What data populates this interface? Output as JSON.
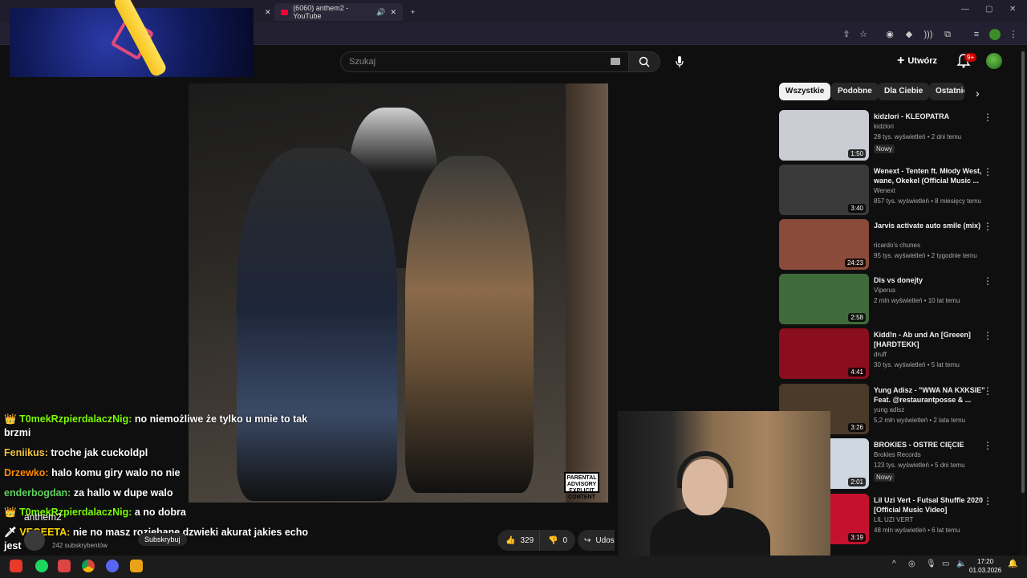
{
  "browser": {
    "tab_title": "(6060) anthem2 - YouTube"
  },
  "youtube": {
    "search_placeholder": "Szukaj",
    "create_label": "Utwórz",
    "notifications_badge": "9+",
    "chips": [
      "Wszystkie",
      "Podobne",
      "Dla Ciebie",
      "Ostatnio"
    ],
    "video": {
      "channel_name": "anthem2",
      "channel_subs": "242 subskrybentów",
      "subscribe_label": "Subskrybuj",
      "likes": "329",
      "dislikes": "0",
      "share_label": "Udos",
      "advisory_text": "PARENTAL ADVISORY EXPLICIT CONTENT"
    },
    "recommendations": [
      {
        "title": "kidzlori - KLEOPATRA",
        "channel": "kidzlori",
        "meta": "28 tys. wyświetleń • 2 dni temu",
        "badge": "Nowy",
        "duration": "1:50",
        "thumb": "#c9ccd2"
      },
      {
        "title": "Wenext - Tenten ft. Młody West, wane, Okekel (Official Music ...",
        "channel": "Wenext",
        "meta": "857 tys. wyświetleń • 8 miesięcy temu",
        "badge": "",
        "duration": "3:40",
        "thumb": "#3a3a3a"
      },
      {
        "title": "Jarvis activate auto smile (mix)",
        "channel": "ricardo's chunes",
        "meta": "95 tys. wyświetleń • 2 tygodnie temu",
        "badge": "",
        "duration": "24:23",
        "thumb": "#8a4b3a"
      },
      {
        "title": "Dis vs donejty",
        "channel": "Viperus",
        "meta": "2 mln wyświetleń • 10 lat temu",
        "badge": "",
        "duration": "2:58",
        "thumb": "#3f6b3a"
      },
      {
        "title": "Kidd!n - Ab und An [Greeen] [HARDTEKK]",
        "channel": "druff",
        "meta": "30 tys. wyświetleń • 5 lat temu",
        "badge": "",
        "duration": "4:41",
        "thumb": "#8a0e1e"
      },
      {
        "title": "Yung Adisz - \"WWA NA KXKSIE\" Feat. @restaurantposse & ...",
        "channel": "yung adisz",
        "meta": "5,2 mln wyświetleń • 2 lata temu",
        "badge": "",
        "duration": "3:26",
        "thumb": "#4a3a2a"
      },
      {
        "title": "BROKIES - OSTRE CIĘCIE",
        "channel": "Brokies Records",
        "meta": "123 tys. wyświetleń • 5 dni temu",
        "badge": "Nowy",
        "duration": "2:01",
        "thumb": "#cfd8e0"
      },
      {
        "title": "Lil Uzi Vert - Futsal Shuffle 2020 [Official Music Video]",
        "channel": "LIL UZI VERT",
        "meta": "48 mln wyświetleń • 6 lat temu",
        "badge": "",
        "duration": "3:19",
        "thumb": "#c4122e"
      }
    ]
  },
  "chat": [
    {
      "user": "T0mekRzpierdalaczNig:",
      "text": "no niemożliwe że tylko u mnie to tak brzmi",
      "color": "#7CFC00",
      "icon": "👑"
    },
    {
      "user": "Feniikus:",
      "text": "troche jak cuckoldpl",
      "color": "#f4c542",
      "icon": ""
    },
    {
      "user": "Drzewko:",
      "text": "halo komu giry walo no nie",
      "color": "#ff8c00",
      "icon": ""
    },
    {
      "user": "enderbogdan:",
      "text": "za hallo w dupe walo",
      "color": "#5fd35f",
      "icon": ""
    },
    {
      "user": "T0mekRzpierdalaczNig:",
      "text": "a no dobra",
      "color": "#7CFC00",
      "icon": "👑"
    },
    {
      "user": "VEGEETA:",
      "text": "nie no masz rozjebane dzwieki akurat jakies echo jest",
      "color": "#ffd700",
      "icon": "🗡"
    }
  ],
  "taskbar": {
    "time": "17:20",
    "date": "01.03.2026"
  },
  "colors": {
    "yt_red": "#ff0033",
    "page_bg": "#0f0f0f"
  }
}
